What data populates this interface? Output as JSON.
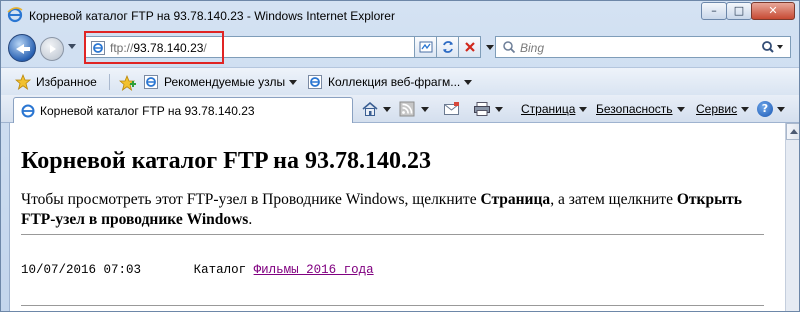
{
  "window": {
    "title": "Корневой каталог FTP на 93.78.140.23 - Windows Internet Explorer",
    "minimize_glyph": "–",
    "maximize_glyph": "□",
    "close_glyph": "✕"
  },
  "address_bar": {
    "scheme": "ftp://",
    "host": "93.78.140.23",
    "path": "/",
    "highlight_color": "#e02424"
  },
  "search": {
    "placeholder": "Bing",
    "engine_icon": "search-icon"
  },
  "favorites_bar": {
    "favorites_label": "Избранное",
    "items": [
      {
        "label": "Рекомендуемые узлы",
        "icon": "ie-page-icon"
      },
      {
        "label": "Коллекция веб-фрагм...",
        "icon": "ie-page-icon"
      }
    ]
  },
  "tab": {
    "title": "Корневой каталог FTP на 93.78.140.23"
  },
  "command_bar": {
    "page_label": "Страница",
    "safety_label": "Безопасность",
    "tools_label": "Сервис",
    "help_glyph": "?"
  },
  "page": {
    "heading": "Корневой каталог FTP на 93.78.140.23",
    "intro_part1": "Чтобы просмотреть этот FTP-узел в Проводнике Windows, щелкните ",
    "intro_bold1": "Страница",
    "intro_part2": ", а затем щелкните ",
    "intro_bold2": "Открыть FTP-узел в проводнике Windows",
    "intro_part3": ".",
    "listing": [
      {
        "date": "10/07/2016",
        "time": "07:03",
        "type": "Каталог",
        "name": "Фильмы 2016 года"
      }
    ],
    "link_color": "#800080"
  },
  "colors": {
    "chrome_background": "#c9d9ee",
    "content_background": "#ffffff"
  }
}
